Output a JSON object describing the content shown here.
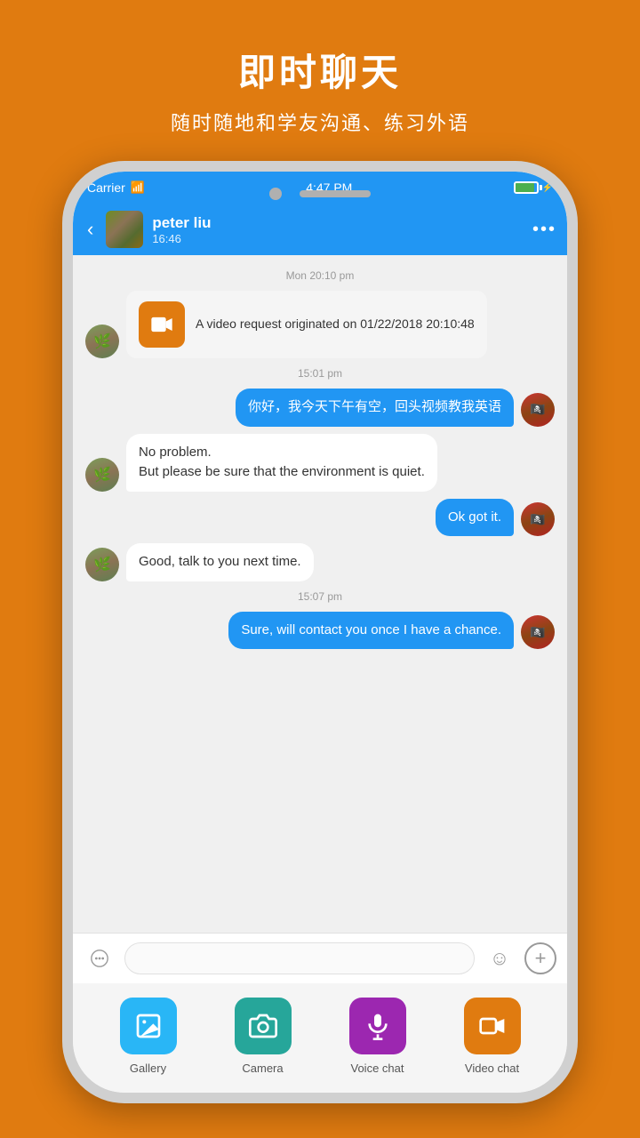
{
  "header": {
    "title": "即时聊天",
    "subtitle": "随时随地和学友沟通、练习外语"
  },
  "statusBar": {
    "carrier": "Carrier",
    "time": "4:47 PM",
    "wifi": true
  },
  "chatHeader": {
    "contactName": "peter liu",
    "contactStatus": "16:46",
    "backLabel": "‹",
    "menuLabel": "•••"
  },
  "messages": [
    {
      "type": "timestamp",
      "text": "Mon 20:10 pm"
    },
    {
      "type": "received-video",
      "text": "A video request originated on 01/22/2018 20:10:48"
    },
    {
      "type": "timestamp",
      "text": "15:01 pm"
    },
    {
      "type": "sent",
      "text": "你好，我今天下午有空，回头视频教我英语"
    },
    {
      "type": "received",
      "text": "No  problem.\nBut  please be sure that the environment is  quiet."
    },
    {
      "type": "sent",
      "text": "Ok got it."
    },
    {
      "type": "received",
      "text": "Good, talk  to you next time."
    },
    {
      "type": "timestamp",
      "text": "15:07 pm"
    },
    {
      "type": "sent",
      "text": "Sure, will contact you once I have a chance."
    }
  ],
  "inputBar": {
    "placeholder": "",
    "voiceIcon": "≋",
    "emojiIcon": "☺",
    "plusIcon": "+"
  },
  "bottomActions": [
    {
      "id": "gallery",
      "label": "Gallery",
      "colorClass": "icon-gallery"
    },
    {
      "id": "camera",
      "label": "Camera",
      "colorClass": "icon-camera"
    },
    {
      "id": "voice",
      "label": "Voice chat",
      "colorClass": "icon-voice"
    },
    {
      "id": "video",
      "label": "Video chat",
      "colorClass": "icon-video"
    }
  ]
}
